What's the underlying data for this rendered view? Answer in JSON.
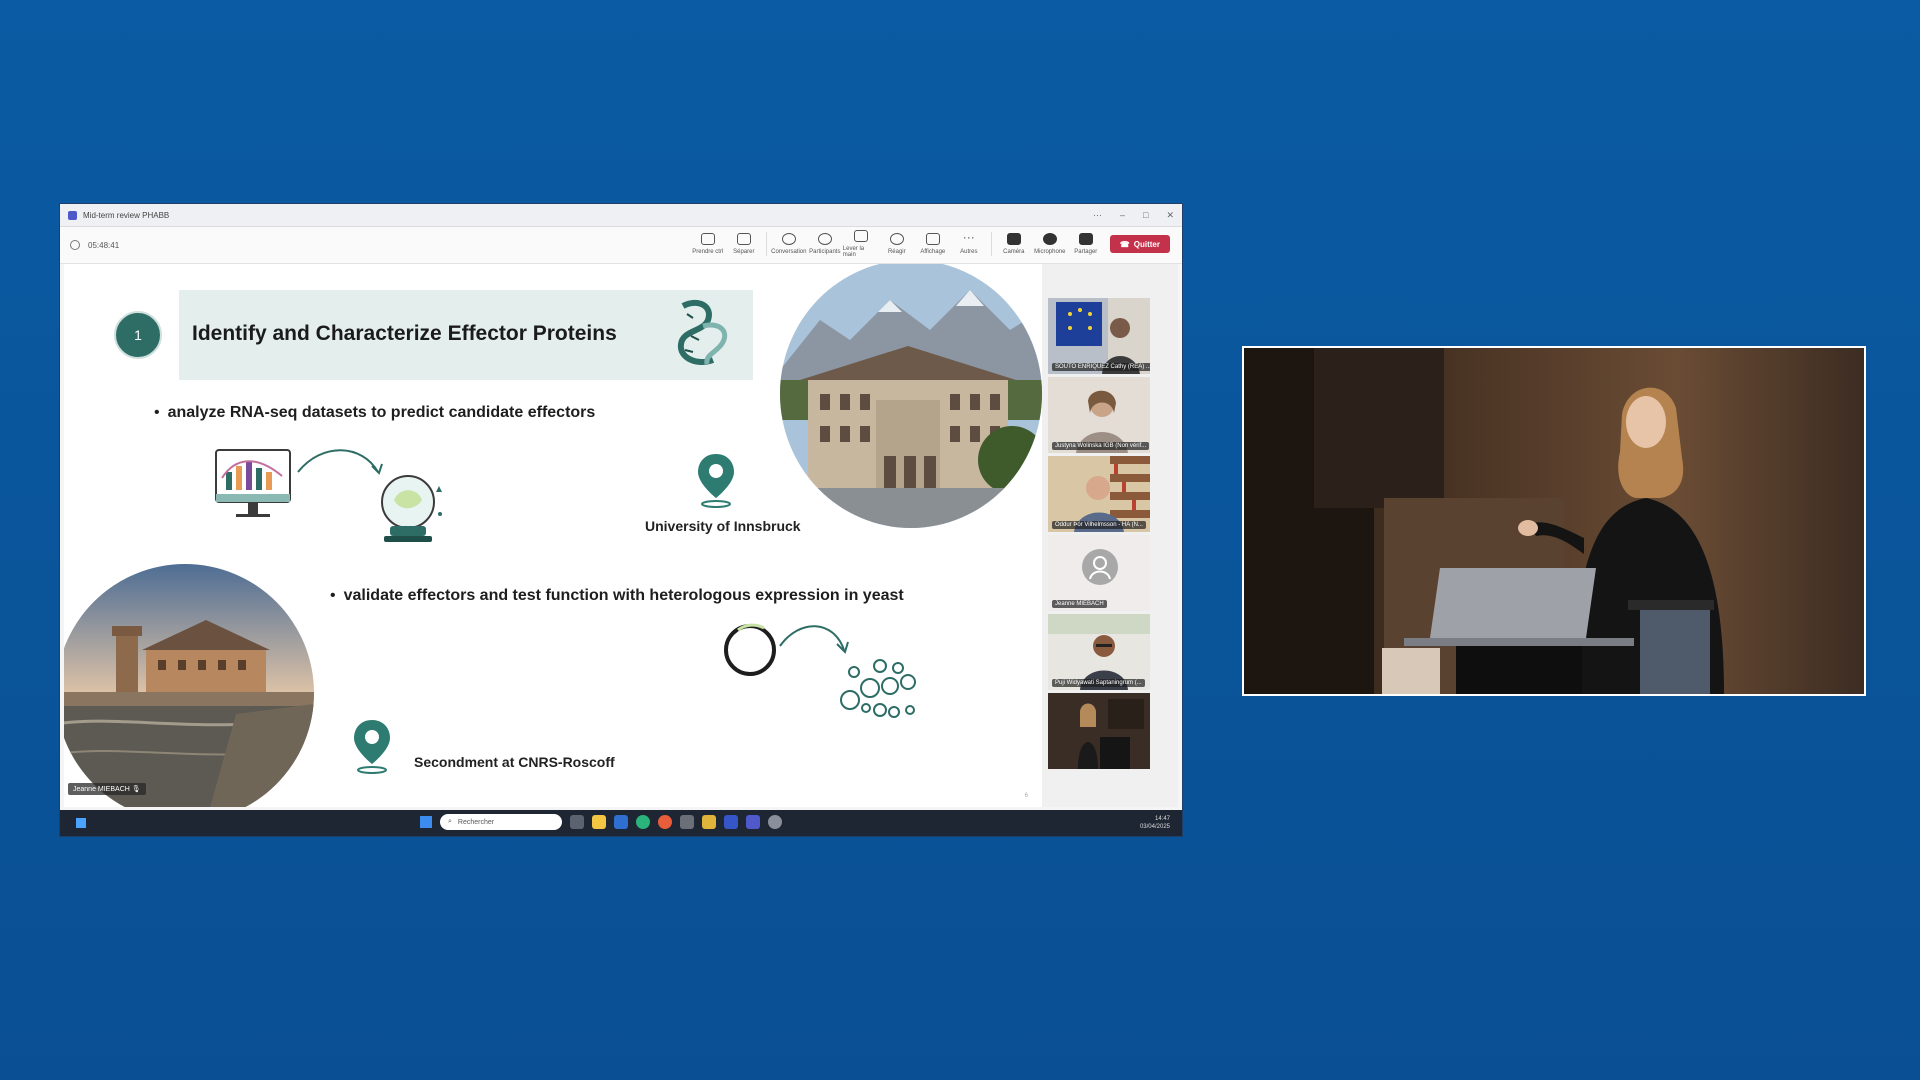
{
  "window": {
    "title": "Mid-term review PHABB",
    "timer": "05:48:41"
  },
  "toolbar": {
    "items": [
      {
        "label": "Prendre ctrl",
        "icon": "take-control-icon"
      },
      {
        "label": "Séparer",
        "icon": "pop-out-icon"
      },
      {
        "label": "Conversation",
        "icon": "chat-icon"
      },
      {
        "label": "Participants",
        "icon": "people-icon"
      },
      {
        "label": "Lever la main",
        "icon": "raise-hand-icon"
      },
      {
        "label": "Réagir",
        "icon": "react-icon"
      },
      {
        "label": "Affichage",
        "icon": "view-icon"
      },
      {
        "label": "Autres",
        "icon": "more-icon"
      },
      {
        "label": "Caméra",
        "icon": "camera-icon"
      },
      {
        "label": "Microphone",
        "icon": "microphone-icon"
      },
      {
        "label": "Partager",
        "icon": "share-icon"
      }
    ],
    "leave_label": "Quitter",
    "leave_color": "#c4314b"
  },
  "slide": {
    "number": "1",
    "title": "Identify and Characterize Effector Proteins",
    "bullet1": "analyze RNA-seq datasets to predict candidate effectors",
    "bullet2": "validate effectors and test function with heterologous expression in yeast",
    "location1": "University of Innsbruck",
    "location2": "Secondment at CNRS-Roscoff",
    "accent_color": "#2e6d66",
    "title_bg": "#e3eeed",
    "page_number": "6"
  },
  "speaker_tag": "Jeanne MIEBACH",
  "participants": [
    {
      "name": "SOUTO ENRIQUEZ Cathy (REA) ..."
    },
    {
      "name": "Justyna Wolinska IGB (Non vérif..."
    },
    {
      "name": "Oddur Þór Vilhelmsson - HA (N..."
    },
    {
      "name": "Jeanne MIEBACH"
    },
    {
      "name": "Puji Widyawati Saptaningrum (..."
    },
    {
      "name": ""
    }
  ],
  "taskbar": {
    "search_placeholder": "Rechercher",
    "time": "14:47",
    "date": "03/04/2025"
  }
}
